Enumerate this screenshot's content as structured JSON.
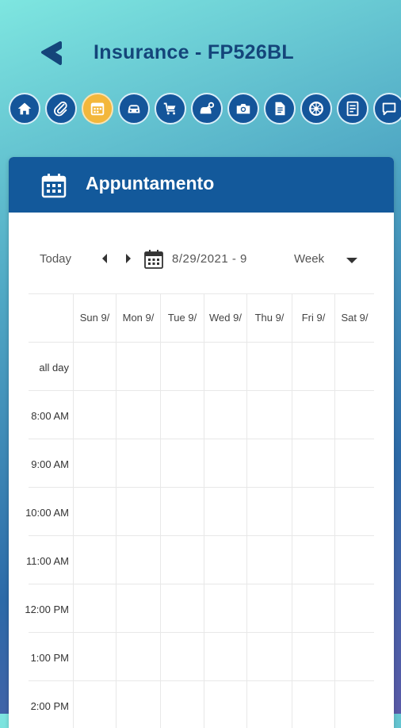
{
  "header": {
    "title": "Insurance - FP526BL"
  },
  "toolbar_icons": [
    {
      "name": "home-icon",
      "active": false
    },
    {
      "name": "paperclip-icon",
      "active": false
    },
    {
      "name": "calendar-icon",
      "active": true
    },
    {
      "name": "car-icon",
      "active": false
    },
    {
      "name": "cart-car-icon",
      "active": false
    },
    {
      "name": "car-key-icon",
      "active": false
    },
    {
      "name": "camera-icon",
      "active": false
    },
    {
      "name": "document-icon",
      "active": false
    },
    {
      "name": "wheel-icon",
      "active": false
    },
    {
      "name": "checklist-icon",
      "active": false
    },
    {
      "name": "chat-icon",
      "active": false
    }
  ],
  "card": {
    "title": "Appuntamento"
  },
  "calendar": {
    "today_label": "Today",
    "range": "8/29/2021 - 9",
    "view": "Week",
    "days": [
      "Sun 9/",
      "Mon 9/",
      "Tue 9/",
      "Wed 9/",
      "Thu 9/",
      "Fri 9/",
      "Sat 9/"
    ],
    "times": [
      "all day",
      "8:00 AM",
      "9:00 AM",
      "10:00 AM",
      "11:00 AM",
      "12:00 PM",
      "1:00 PM",
      "2:00 PM"
    ]
  },
  "colors": {
    "primary": "#13599b",
    "accent": "#f3b73b",
    "title": "#14457a"
  }
}
